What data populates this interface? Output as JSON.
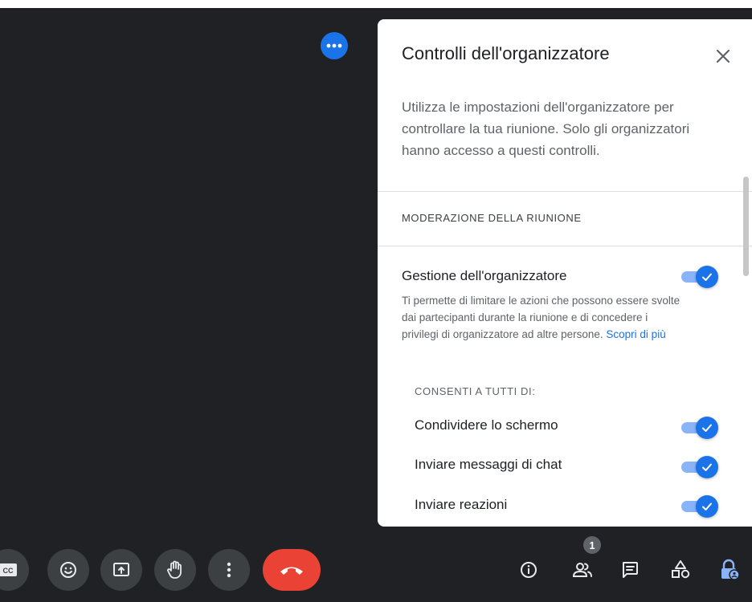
{
  "panel": {
    "title": "Controlli dell'organizzatore",
    "intro": "Utilizza le impostazioni dell'organizzatore per controllare la tua riunione. Solo gli organizzatori hanno accesso a questi controlli.",
    "section_title": "MODERAZIONE DELLA RIUNIONE",
    "host_management": {
      "title": "Gestione dell'organizzatore",
      "description": "Ti permette di limitare le azioni che possono essere svolte dai partecipanti durante la riunione e di concedere i privilegi di organizzatore ad altre persone.",
      "link": "Scopri di più",
      "enabled": true
    },
    "allow_all_label": "CONSENTI A TUTTI DI:",
    "permissions": [
      {
        "label": "Condividere lo schermo",
        "enabled": true
      },
      {
        "label": "Inviare messaggi di chat",
        "enabled": true
      },
      {
        "label": "Inviare reazioni",
        "enabled": true
      }
    ]
  },
  "toolbar": {
    "participants_count": "1"
  },
  "colors": {
    "accent": "#1a73e8",
    "toggle_track": "#8ab4f8",
    "end_call": "#ea4335",
    "background": "#202124",
    "control_bg": "#3c4043"
  }
}
